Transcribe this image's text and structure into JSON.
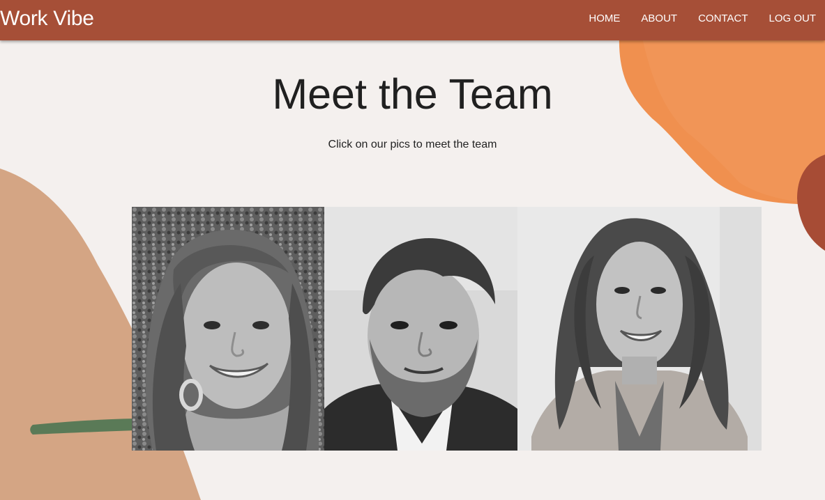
{
  "window": {
    "title": "Work Vibe"
  },
  "navbar": {
    "brand": "Work Vibe",
    "links": [
      {
        "label": "HOME"
      },
      {
        "label": "ABOUT"
      },
      {
        "label": "CONTACT"
      },
      {
        "label": "LOG OUT"
      }
    ]
  },
  "main": {
    "title": "Meet the Team",
    "subtitle": "Click on our pics to meet the team"
  },
  "colors": {
    "navbar": "#a64f37",
    "background": "#f4f0ee",
    "blob_tan": "#d4a584",
    "blob_orange": "#f0904f",
    "blob_rust": "#a74c35",
    "stripe_green": "#5a7a57"
  }
}
